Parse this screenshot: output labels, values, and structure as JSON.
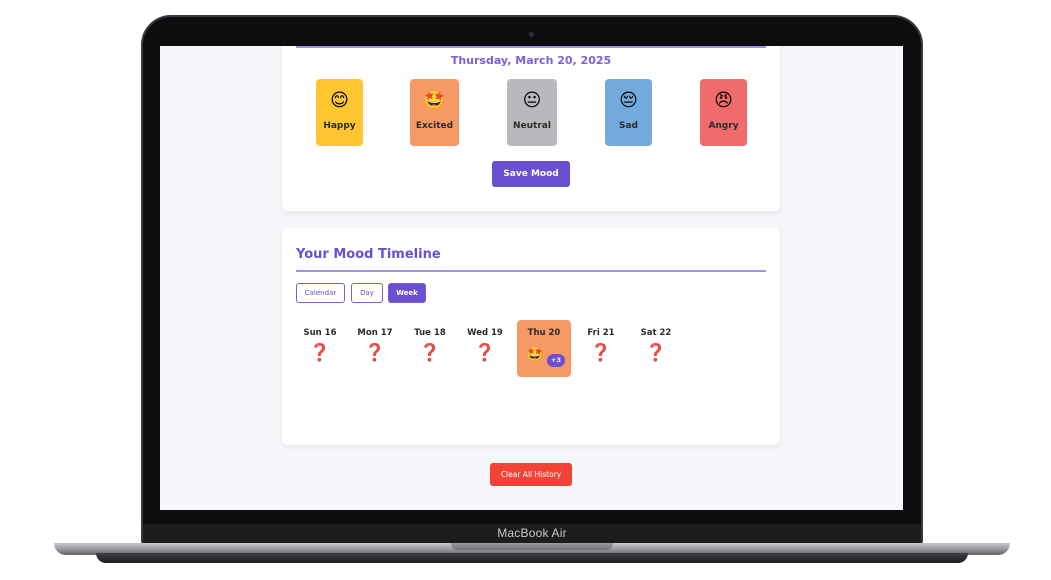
{
  "device": {
    "brand": "MacBook Air"
  },
  "mood_entry": {
    "date": "Thursday, March 20, 2025",
    "moods": [
      {
        "label": "Happy",
        "icon": "😊",
        "color": "#ffc630"
      },
      {
        "label": "Excited",
        "icon": "🤩",
        "color": "#f79967"
      },
      {
        "label": "Neutral",
        "icon": "😐",
        "color": "#b9b9bd"
      },
      {
        "label": "Sad",
        "icon": "😔",
        "color": "#73aadb"
      },
      {
        "label": "Angry",
        "icon": "😠",
        "color": "#f06b6b"
      }
    ],
    "save_label": "Save Mood"
  },
  "timeline": {
    "title": "Your Mood Timeline",
    "views": [
      "Calendar",
      "Day",
      "Week"
    ],
    "active_view": "Week",
    "days": [
      {
        "label": "Sun 16",
        "mark": "❓"
      },
      {
        "label": "Mon 17",
        "mark": "❓"
      },
      {
        "label": "Tue 18",
        "mark": "❓"
      },
      {
        "label": "Wed 19",
        "mark": "❓"
      },
      {
        "label": "Thu 20",
        "mood_icon": "🤩",
        "extra": "+3",
        "today": true
      },
      {
        "label": "Fri 21",
        "mark": "❓"
      },
      {
        "label": "Sat 22",
        "mark": "❓"
      }
    ]
  },
  "clear_label": "Clear All History"
}
